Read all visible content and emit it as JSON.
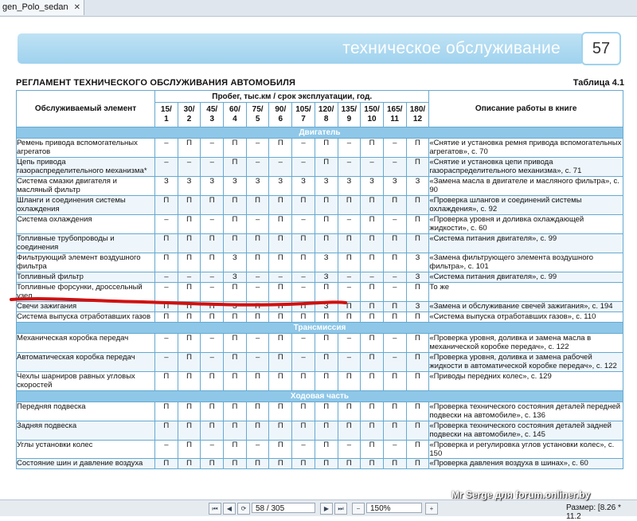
{
  "tab": {
    "title": "gen_Polo_sedan"
  },
  "header": {
    "banner_text": "техническое обслуживание",
    "page_number": "57"
  },
  "doc": {
    "title": "РЕГЛАМЕНТ ТЕХНИЧЕСКОГО ОБСЛУЖИВАНИЯ АВТОМОБИЛЯ",
    "table_label": "Таблица 4.1"
  },
  "table": {
    "header": {
      "element": "Обслуживаемый элемент",
      "mileage": "Пробег, тыс.км / срок эксплуатации, год.",
      "description": "Описание работы в книге"
    },
    "intervals": [
      {
        "km": "15/",
        "yr": "1"
      },
      {
        "km": "30/",
        "yr": "2"
      },
      {
        "km": "45/",
        "yr": "3"
      },
      {
        "km": "60/",
        "yr": "4"
      },
      {
        "km": "75/",
        "yr": "5"
      },
      {
        "km": "90/",
        "yr": "6"
      },
      {
        "km": "105/",
        "yr": "7"
      },
      {
        "km": "120/",
        "yr": "8"
      },
      {
        "km": "135/",
        "yr": "9"
      },
      {
        "km": "150/",
        "yr": "10"
      },
      {
        "km": "165/",
        "yr": "11"
      },
      {
        "km": "180/",
        "yr": "12"
      }
    ],
    "sections": [
      {
        "title": "Двигатель",
        "rows": [
          {
            "name": "Ремень привода вспомогательных агрегатов",
            "values": [
              "–",
              "П",
              "–",
              "П",
              "–",
              "П",
              "–",
              "П",
              "–",
              "П",
              "–",
              "П"
            ],
            "desc": "«Снятие и установка ремня привода вспомогательных агрегатов», с. 70"
          },
          {
            "name": "Цепь привода газораспределительного механизма*",
            "values": [
              "–",
              "–",
              "–",
              "П",
              "–",
              "–",
              "–",
              "П",
              "–",
              "–",
              "–",
              "П"
            ],
            "desc": "«Снятие и установка цепи привода газораспределительного механизма», с. 71"
          },
          {
            "name": "Система смазки двигателя и масляный фильтр",
            "values": [
              "З",
              "З",
              "З",
              "З",
              "З",
              "З",
              "З",
              "З",
              "З",
              "З",
              "З",
              "З"
            ],
            "desc": "«Замена масла в двигателе и масляного фильтра», с. 90"
          },
          {
            "name": "Шланги и соединения системы охлаждения",
            "values": [
              "П",
              "П",
              "П",
              "П",
              "П",
              "П",
              "П",
              "П",
              "П",
              "П",
              "П",
              "П"
            ],
            "desc": "«Проверка шлангов и соединений системы охлаждения», с. 92"
          },
          {
            "name": "Система охлаждения",
            "values": [
              "–",
              "П",
              "–",
              "П",
              "–",
              "П",
              "–",
              "П",
              "–",
              "П",
              "–",
              "П"
            ],
            "desc": "«Проверка уровня и доливка охлаждающей жидкости», с. 60"
          },
          {
            "name": "Топливные трубопроводы и соединения",
            "values": [
              "П",
              "П",
              "П",
              "П",
              "П",
              "П",
              "П",
              "П",
              "П",
              "П",
              "П",
              "П"
            ],
            "desc": "«Система питания двигателя», с. 99"
          },
          {
            "name": "Фильтрующий элемент воздушного фильтра",
            "values": [
              "П",
              "П",
              "П",
              "З",
              "П",
              "П",
              "П",
              "З",
              "П",
              "П",
              "П",
              "З"
            ],
            "desc": "«Замена фильтрующего элемента воздушного фильтра», с. 101"
          },
          {
            "name": "Топливный фильтр",
            "values": [
              "–",
              "–",
              "–",
              "З",
              "–",
              "–",
              "–",
              "З",
              "–",
              "–",
              "–",
              "З"
            ],
            "desc": "«Система питания двигателя», с. 99"
          },
          {
            "name": "Топливные форсунки, дроссельный узел",
            "values": [
              "–",
              "П",
              "–",
              "П",
              "–",
              "П",
              "–",
              "П",
              "–",
              "П",
              "–",
              "П"
            ],
            "desc": "То же"
          },
          {
            "name": "Свечи зажигания",
            "values": [
              "П",
              "П",
              "П",
              "З",
              "П",
              "П",
              "П",
              "З",
              "П",
              "П",
              "П",
              "З"
            ],
            "desc": "«Замена и обслуживание свечей зажигания», с. 194"
          },
          {
            "name": "Система выпуска отработавших газов",
            "values": [
              "П",
              "П",
              "П",
              "П",
              "П",
              "П",
              "П",
              "П",
              "П",
              "П",
              "П",
              "П"
            ],
            "desc": "«Система выпуска отработавших газов», с. 110"
          }
        ]
      },
      {
        "title": "Трансмиссия",
        "rows": [
          {
            "name": "Механическая коробка передач",
            "values": [
              "–",
              "П",
              "–",
              "П",
              "–",
              "П",
              "–",
              "П",
              "–",
              "П",
              "–",
              "П"
            ],
            "desc": "«Проверка уровня, доливка и замена масла в механической коробке передач», с. 122"
          },
          {
            "name": "Автоматическая коробка передач",
            "values": [
              "–",
              "П",
              "–",
              "П",
              "–",
              "П",
              "–",
              "П",
              "–",
              "П",
              "–",
              "П"
            ],
            "desc": "«Проверка уровня, доливка и замена рабочей жидкости в автоматической коробке передач», с. 122"
          },
          {
            "name": "Чехлы шарниров равных угловых скоростей",
            "values": [
              "П",
              "П",
              "П",
              "П",
              "П",
              "П",
              "П",
              "П",
              "П",
              "П",
              "П",
              "П"
            ],
            "desc": "«Приводы передних колес», с. 129"
          }
        ]
      },
      {
        "title": "Ходовая часть",
        "rows": [
          {
            "name": "Передняя подвеска",
            "values": [
              "П",
              "П",
              "П",
              "П",
              "П",
              "П",
              "П",
              "П",
              "П",
              "П",
              "П",
              "П"
            ],
            "desc": "«Проверка технического состояния деталей передней подвески на автомобиле», с. 136"
          },
          {
            "name": "Задняя подвеска",
            "values": [
              "П",
              "П",
              "П",
              "П",
              "П",
              "П",
              "П",
              "П",
              "П",
              "П",
              "П",
              "П"
            ],
            "desc": "«Проверка технического состояния деталей задней подвески на автомобиле», с. 145"
          },
          {
            "name": "Углы установки колес",
            "values": [
              "–",
              "П",
              "–",
              "П",
              "–",
              "П",
              "–",
              "П",
              "–",
              "П",
              "–",
              "П"
            ],
            "desc": "«Проверка и регулировка углов установки колес», с. 150"
          },
          {
            "name": "Состояние шин и давление воздуха",
            "values": [
              "П",
              "П",
              "П",
              "П",
              "П",
              "П",
              "П",
              "П",
              "П",
              "П",
              "П",
              "П"
            ],
            "desc": "«Проверка давления воздуха в шинах», с. 60"
          }
        ]
      }
    ]
  },
  "statusbar": {
    "page_field": "58 / 305",
    "zoom": "150%",
    "size_label": "Размер: [8.26 * 11.2"
  },
  "watermark": "Mr Serge для forum.onliner.by",
  "colors": {
    "accent": "#8ec7e8",
    "border": "#67a9cf",
    "highlight_stroke": "#d01010"
  }
}
